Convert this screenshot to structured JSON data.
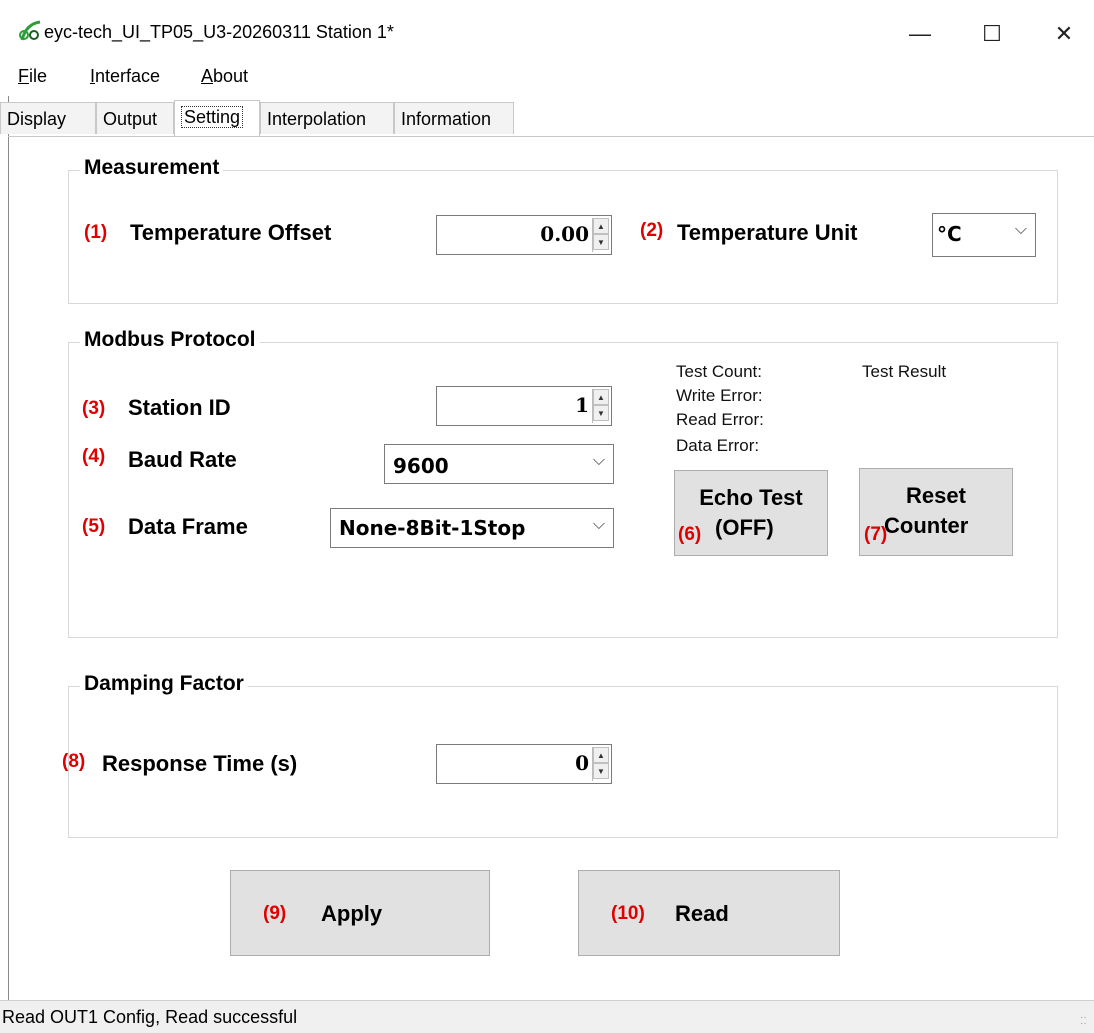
{
  "window": {
    "title": "eyc-tech_UI_TP05_U3-20260311  Station 1*",
    "logo_text": "eyc",
    "minimize": "—",
    "maximize": "☐",
    "close": "✕"
  },
  "menu": [
    {
      "label": "File",
      "accel": "F",
      "rest": "ile"
    },
    {
      "label": "Interface",
      "accel": "I",
      "rest": "nterface"
    },
    {
      "label": "About",
      "accel": "A",
      "rest": "bout"
    }
  ],
  "tabs": [
    "Display",
    "Output",
    "Setting",
    "Interpolation",
    "Information"
  ],
  "active_tab": "Setting",
  "measurement": {
    "title": "Measurement",
    "temp_offset_num": "(1)",
    "temp_offset_label": "Temperature Offset",
    "temp_offset_value": "0.00",
    "temp_unit_num": "(2)",
    "temp_unit_label": "Temperature Unit",
    "temp_unit_value": "°C"
  },
  "modbus": {
    "title": "Modbus Protocol",
    "station_num": "(3)",
    "station_label": "Station ID",
    "station_value": "1",
    "baud_num": "(4)",
    "baud_label": "Baud Rate",
    "baud_value": "9600",
    "frame_num": "(5)",
    "frame_label": "Data Frame",
    "frame_value": "None-8Bit-1Stop",
    "test_count": "Test Count:",
    "test_result": "Test Result",
    "write_error": "Write Error:",
    "read_error": "Read Error:",
    "data_error": "Data Error:",
    "echo_line1": "Echo Test",
    "echo_num": "(6)",
    "echo_line2": "(OFF)",
    "reset_line1": "Reset",
    "reset_num": "(7)",
    "reset_line2": "Counter"
  },
  "damping": {
    "title": "Damping Factor",
    "response_num": "(8)",
    "response_label": "Response Time (s)",
    "response_value": "0"
  },
  "actions": {
    "apply_num": "(9)",
    "apply_label": "Apply",
    "read_num": "(10)",
    "read_label": "Read"
  },
  "status": "Read OUT1 Config,   Read successful"
}
